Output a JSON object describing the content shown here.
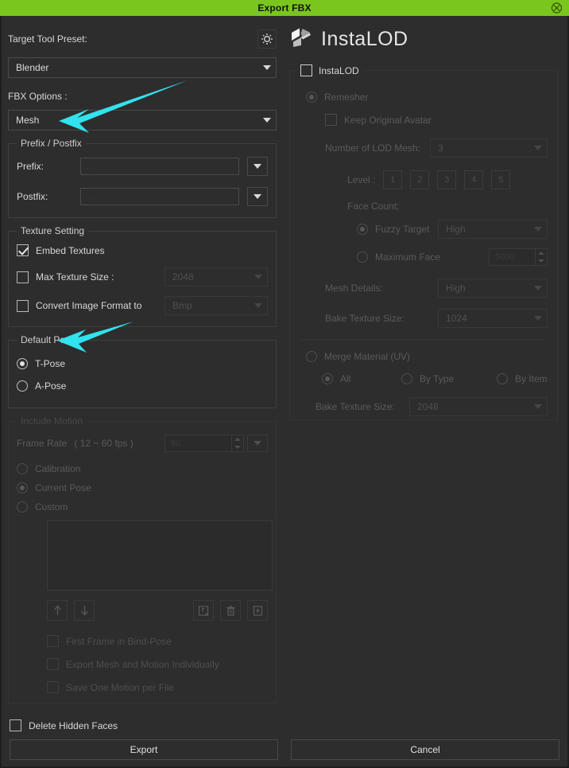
{
  "titlebar": {
    "title": "Export FBX",
    "close_icon": "close-circle-icon"
  },
  "left": {
    "target_tool_preset_label": "Target Tool Preset:",
    "settings_icon": "sun-settings-icon",
    "preset_value": "Blender",
    "fbx_options_label": "FBX Options :",
    "fbx_options_value": "Mesh",
    "prefix_postfix": {
      "title": "Prefix / Postfix",
      "prefix_label": "Prefix:",
      "prefix_value": "...",
      "postfix_label": "Postfix:",
      "postfix_value": "..."
    },
    "texture_setting": {
      "title": "Texture Setting",
      "embed_textures_label": "Embed Textures",
      "embed_textures_checked": true,
      "max_texture_size_label": "Max Texture Size :",
      "max_texture_size_value": "2048",
      "convert_image_format_label": "Convert Image Format to",
      "convert_image_format_value": "Bmp"
    },
    "default_pose": {
      "title": "Default Pose",
      "t_pose_label": "T-Pose",
      "a_pose_label": "A-Pose"
    },
    "include_motion": {
      "title": "Include Motion",
      "frame_rate_label": "Frame Rate",
      "frame_rate_range": "( 12 ~ 60 fps )",
      "frame_rate_value": "60",
      "calibration_label": "Calibration",
      "current_pose_label": "Current Pose",
      "custom_label": "Custom",
      "move_up_icon": "arrow-up-icon",
      "move_down_icon": "arrow-down-icon",
      "load_icon": "load-file-icon",
      "delete_icon": "trash-icon",
      "add_icon": "add-file-icon",
      "first_frame_bind_pose_label": "First Frame in Bind-Pose",
      "export_mesh_motion_label": "Export Mesh and Motion Individually",
      "save_one_motion_label": "Save One Motion per File"
    },
    "delete_hidden_faces_label": "Delete Hidden Faces",
    "export_button": "Export"
  },
  "right": {
    "brand_name": "InstaLOD",
    "brand_logo_icon": "instalod-cube-icon",
    "instalod_group_label": "InstaLOD",
    "remesher_label": "Remesher",
    "keep_original_avatar_label": "Keep Original Avatar",
    "number_of_lod_mesh_label": "Number of LOD Mesh:",
    "number_of_lod_mesh_value": "3",
    "level_label": "Level :",
    "levels": [
      "1",
      "2",
      "3",
      "4",
      "5"
    ],
    "face_count_label": "Face Count:",
    "fuzzy_target_label": "Fuzzy Target",
    "fuzzy_target_value": "High",
    "maximum_face_label": "Maximum Face",
    "maximum_face_value": "5000",
    "mesh_details_label": "Mesh Details:",
    "mesh_details_value": "High",
    "bake_texture_size_label": "Bake Texture Size:",
    "bake_texture_size_value": "1024",
    "merge_material_label": "Merge Material (UV)",
    "merge_all_label": "All",
    "merge_by_type_label": "By Type",
    "merge_by_item_label": "By Item",
    "merge_bake_texture_size_label": "Bake Texture Size:",
    "merge_bake_texture_size_value": "2048",
    "cancel_button": "Cancel"
  },
  "annotations": {
    "arrow_color": "#31e3ee",
    "arrow_1_target": "fbx-options-combo",
    "arrow_2_target": "t-pose-radio"
  }
}
